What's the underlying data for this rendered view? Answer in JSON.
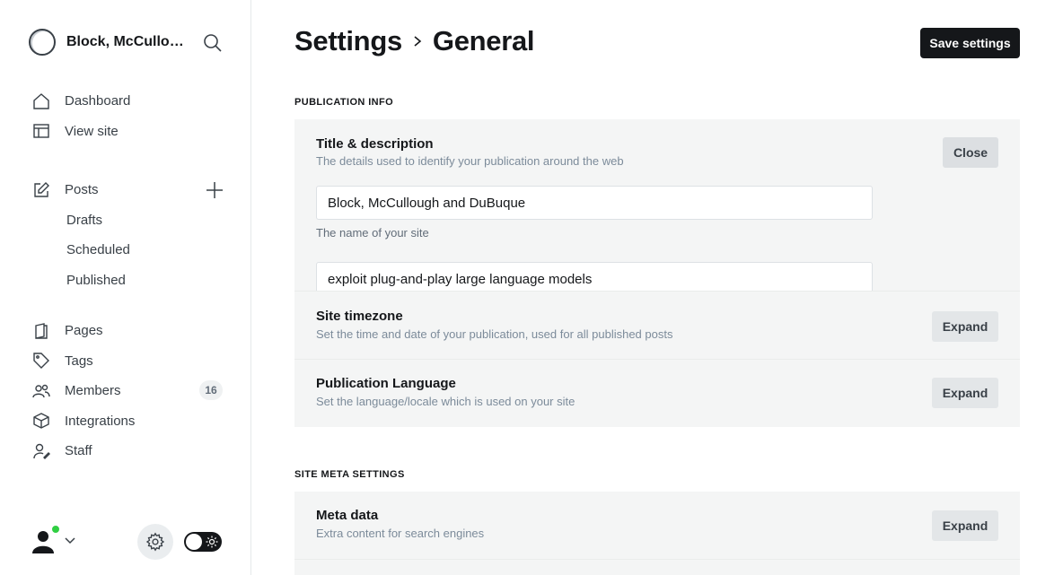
{
  "sidebar": {
    "brand_name": "Block, McCullough and DuBuque",
    "nav_primary": [
      {
        "label": "Dashboard",
        "icon": "home-icon"
      },
      {
        "label": "View site",
        "icon": "layout-icon"
      }
    ],
    "posts": {
      "label": "Posts",
      "icon": "edit-icon"
    },
    "post_subitems": [
      "Drafts",
      "Scheduled",
      "Published"
    ],
    "nav_secondary": [
      {
        "label": "Pages",
        "icon": "pages-icon"
      },
      {
        "label": "Tags",
        "icon": "tag-icon"
      },
      {
        "label": "Members",
        "icon": "members-icon",
        "badge": "16"
      },
      {
        "label": "Integrations",
        "icon": "cube-icon"
      },
      {
        "label": "Staff",
        "icon": "staff-icon"
      }
    ]
  },
  "header": {
    "title": "Settings",
    "subtitle": "General",
    "save_label": "Save settings"
  },
  "sections": {
    "publication_info": "PUBLICATION INFO",
    "site_meta": "SITE META SETTINGS"
  },
  "title_description": {
    "title": "Title & description",
    "desc": "The details used to identify your publication around the web",
    "close_label": "Close",
    "site_title_value": "Block, McCullough and DuBuque",
    "site_title_hint": "The name of your site",
    "description_value": "exploit plug-and-play large language models"
  },
  "timezone": {
    "title": "Site timezone",
    "desc": "Set the time and date of your publication, used for all published posts",
    "button": "Expand"
  },
  "language": {
    "title": "Publication Language",
    "desc": "Set the language/locale which is used on your site",
    "button": "Expand"
  },
  "meta_data": {
    "title": "Meta data",
    "desc": "Extra content for search engines",
    "button": "Expand"
  },
  "colors": {
    "accent": "#15171a",
    "online": "#30cf43"
  }
}
